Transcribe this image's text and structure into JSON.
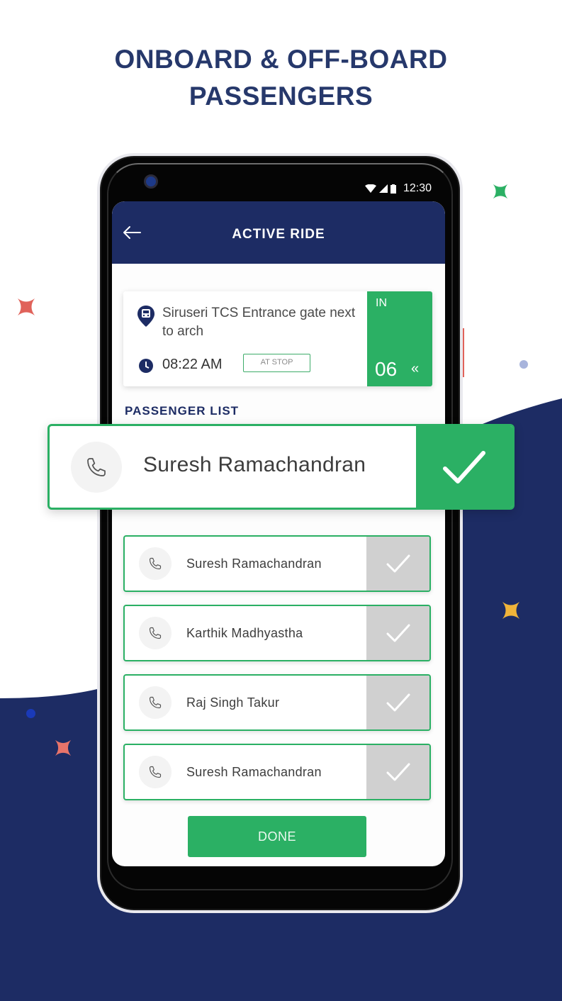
{
  "headline": {
    "line1": "ONBOARD & OFF-BOARD",
    "line2": "PASSENGERS"
  },
  "colors": {
    "navy": "#1d2c64",
    "green": "#2bb064",
    "inactive_check": "#d0d0d0",
    "star_red": "#e0625a",
    "star_green": "#2bb064",
    "star_yellow": "#f0b43a"
  },
  "status_bar": {
    "time": "12:30",
    "icons": [
      "wifi-icon",
      "signal-icon",
      "battery-icon"
    ]
  },
  "app_bar": {
    "back_icon": "arrow-left-icon",
    "title": "ACTIVE RIDE"
  },
  "stop_card": {
    "stop_icon": "bus-pin-icon",
    "stop_name": "Siruseri TCS Entrance gate next to arch",
    "time_icon": "clock-icon",
    "time": "08:22 AM",
    "status_badge": "AT STOP",
    "direction_label": "IN",
    "count": "06",
    "collapse_icon": "«"
  },
  "passenger_list": {
    "title": "PASSENGER LIST",
    "highlighted": {
      "name": "Suresh Ramachandran",
      "checked": true
    },
    "items": [
      {
        "name": "Suresh Ramachandran",
        "checked": false
      },
      {
        "name": "Karthik Madhyastha",
        "checked": false
      },
      {
        "name": "Raj Singh Takur",
        "checked": false
      },
      {
        "name": "Suresh Ramachandran",
        "checked": false
      }
    ]
  },
  "done_button": "DONE"
}
